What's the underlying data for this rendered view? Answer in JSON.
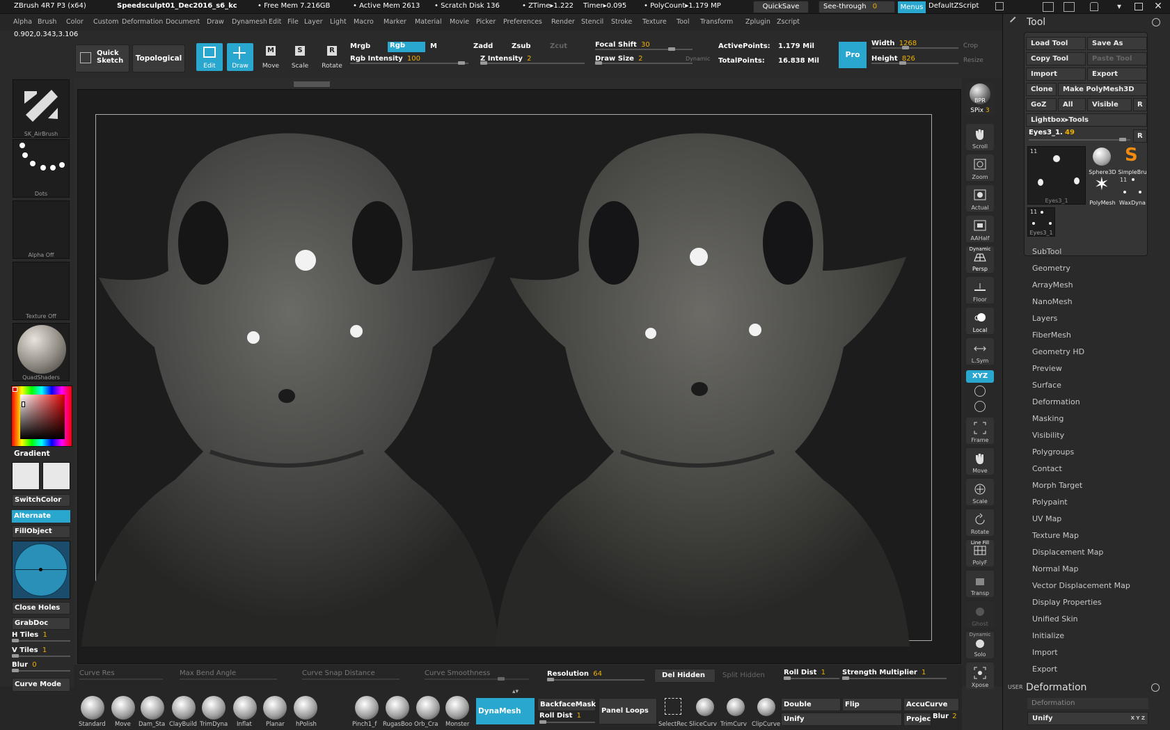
{
  "title": {
    "app": "ZBrush 4R7 P3 (x64)",
    "doc": "Speedsculpt01_Dec2016_s6_kc",
    "free_mem": "• Free Mem 7.216GB",
    "active_mem": "• Active Mem 2613",
    "scratch": "• Scratch Disk 136",
    "ztime": "• ZTime▸1.222",
    "timer": "Timer▸0.095",
    "polycount": "• PolyCount▸1.179 MP",
    "quicksave": "QuickSave",
    "seethrough": "See-through",
    "seethrough_val": "0",
    "menus": "Menus",
    "zscript": "DefaultZScript"
  },
  "menubar": [
    "Alpha",
    "Brush",
    "Color",
    "Custom",
    "Deformation",
    "Document",
    "Draw",
    "Dynamesh",
    "Edit",
    "File",
    "Layer",
    "Light",
    "Macro",
    "Marker",
    "Material",
    "Movie",
    "Picker",
    "Preferences",
    "Render",
    "Stencil",
    "Stroke",
    "Texture",
    "Tool",
    "Transform",
    "Zplugin",
    "Zscript"
  ],
  "coords": "0.902,0.343,3.106",
  "toolbar": {
    "quick_sketch": "Quick Sketch",
    "topological": "Topological",
    "edit": "Edit",
    "draw": "Draw",
    "move": "Move",
    "scale": "Scale",
    "rotate": "Rotate",
    "mrgb": "Mrgb",
    "rgb": "Rgb",
    "m": "M",
    "rgb_intensity_label": "Rgb Intensity",
    "rgb_intensity": "100",
    "zadd": "Zadd",
    "zsub": "Zsub",
    "zcut": "Zcut",
    "z_intensity_label": "Z Intensity",
    "z_intensity": "2",
    "focal_shift_label": "Focal Shift",
    "focal_shift": "30",
    "draw_size_label": "Draw Size",
    "draw_size": "2",
    "dynamic": "Dynamic",
    "active_points_label": "ActivePoints:",
    "active_points": "1.179 Mil",
    "total_points_label": "TotalPoints:",
    "total_points": "16.838 Mil",
    "pro": "Pro",
    "width_label": "Width",
    "width": "1268",
    "height_label": "Height",
    "height": "826",
    "crop": "Crop",
    "resize": "Resize"
  },
  "leftshelf": {
    "brush": "SK_AirBrush",
    "stroke": "Dots",
    "alpha": "Alpha  Off",
    "texture": "Texture  Off",
    "material": "QuadShaders",
    "gradient": "Gradient",
    "switchcolor": "SwitchColor",
    "alternate": "Alternate",
    "fillobject": "FillObject",
    "close_holes": "Close Holes",
    "grabdoc": "GrabDoc",
    "htiles_label": "H Tiles",
    "htiles": "1",
    "vtiles_label": "V Tiles",
    "vtiles": "1",
    "blur_label": "Blur",
    "blur": "0",
    "curve_mode": "Curve Mode",
    "primary_color": "#e8e8e8",
    "secondary_color": "#e8e8e8"
  },
  "rightshelf": {
    "bpr": "BPR",
    "spix_label": "SPix",
    "spix": "3",
    "scroll": "Scroll",
    "zoom": "Zoom",
    "actual": "Actual",
    "aahalf": "AAHalf",
    "persp_top": "Dynamic",
    "persp": "Persp",
    "floor": "Floor",
    "local": "Local",
    "lsym": "L.Sym",
    "xyz": "XYZ",
    "frame": "Frame",
    "move": "Move",
    "scale": "Scale",
    "rotate": "Rotate",
    "polyf_top": "Line Fill",
    "polyf": "PolyF",
    "transp": "Transp",
    "ghost": "Ghost",
    "solo_top": "Dynamic",
    "solo": "Solo",
    "xpose": "Xpose"
  },
  "panel": {
    "title": "Tool",
    "load_tool": "Load Tool",
    "save_as": "Save As",
    "copy_tool": "Copy Tool",
    "paste_tool": "Paste Tool",
    "import": "Import",
    "export": "Export",
    "clone": "Clone",
    "make_polymesh": "Make PolyMesh3D",
    "goz": "GoZ",
    "all": "All",
    "visible": "Visible",
    "r": "R",
    "lightbox": "Lightbox▸Tools",
    "current_tool": "Eyes3_1.",
    "current_tool_val": "49",
    "thumbs": [
      {
        "label": "Eyes3_1",
        "count": "11"
      },
      {
        "label": "Sphere3D",
        "count": ""
      },
      {
        "label": "SimpleBru",
        "count": ""
      },
      {
        "label": "PolyMesh",
        "count": ""
      },
      {
        "label": "WaxDyna",
        "count": "11"
      },
      {
        "label": "Eyes3_1",
        "count": "11"
      }
    ],
    "sections": [
      "SubTool",
      "Geometry",
      "ArrayMesh",
      "NanoMesh",
      "Layers",
      "FiberMesh",
      "Geometry HD",
      "Preview",
      "Surface",
      "Deformation",
      "Masking",
      "Visibility",
      "Polygroups",
      "Contact",
      "Morph Target",
      "Polypaint",
      "UV Map",
      "Texture Map",
      "Displacement Map",
      "Normal Map",
      "Vector Displacement Map",
      "Display Properties",
      "Unified Skin",
      "Initialize",
      "Import",
      "Export"
    ],
    "user": "USER",
    "deformation_title": "Deformation",
    "deformation_sub": "Deformation",
    "unify": "Unify",
    "unify_tag": "X Y Z"
  },
  "bottom": {
    "curve_res": "Curve Res",
    "max_bend": "Max Bend Angle",
    "curve_snap": "Curve Snap Distance",
    "curve_smooth": "Curve Smoothness",
    "resolution_label": "Resolution",
    "resolution": "64",
    "del_hidden": "Del Hidden",
    "split_hidden": "Split Hidden",
    "roll_dist_label": "Roll Dist",
    "roll_dist": "1",
    "strength_mult_label": "Strength Multiplier",
    "strength_mult": "1",
    "brushes": [
      "Standard",
      "Move",
      "Dam_Sta",
      "ClayBuild",
      "TrimDyna",
      "Inflat",
      "Planar",
      "hPolish",
      "Pinch1_f",
      "RugasBoo",
      "Orb_Cra",
      "Monster"
    ],
    "dynamesh": "DynaMesh",
    "backface": "BackfaceMask",
    "roll_dist2_label": "Roll Dist",
    "roll_dist2": "1",
    "panel_loops": "Panel Loops",
    "tools": [
      "SelectRec",
      "SliceCurv",
      "TrimCurv",
      "ClipCurve"
    ],
    "double": "Double",
    "flip": "Flip",
    "accucurve": "AccuCurve",
    "unify": "Unify",
    "projec": "Projec",
    "blur_label": "Blur",
    "blur": "2"
  }
}
